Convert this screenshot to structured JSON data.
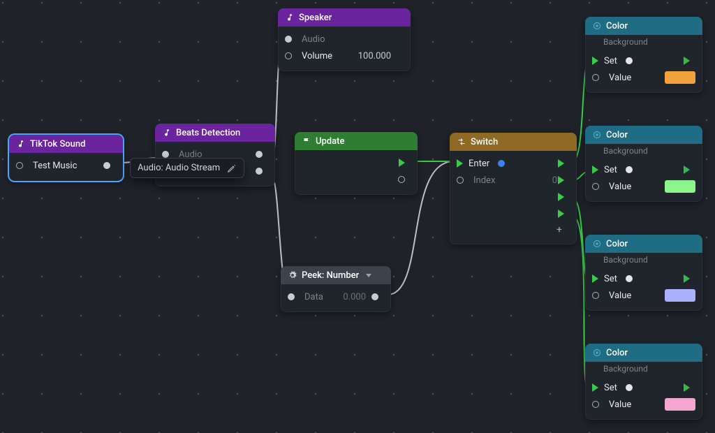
{
  "nodes": {
    "tiktok": {
      "title": "TikTok Sound",
      "out_label": "Test Music"
    },
    "beats": {
      "title": "Beats Detection",
      "audio_label": "Audio"
    },
    "speaker": {
      "title": "Speaker",
      "audio_label": "Audio",
      "volume_label": "Volume",
      "volume_value": "100.000"
    },
    "update": {
      "title": "Update"
    },
    "peek": {
      "title": "Peek: Number",
      "data_label": "Data",
      "data_value": "0.000"
    },
    "switch": {
      "title": "Switch",
      "enter_label": "Enter",
      "index_label": "Index",
      "index_value": "0"
    },
    "color": {
      "title": "Color",
      "subtitle": "Background",
      "set_label": "Set",
      "value_label": "Value",
      "swatches": [
        "#f2a23c",
        "#8af58a",
        "#aab2ff",
        "#f5a6d0"
      ]
    }
  },
  "tooltip": {
    "text": "Audio: Audio Stream"
  },
  "colors": {
    "wire_gray": "#b9bec7",
    "wire_green": "#3acb4a"
  }
}
